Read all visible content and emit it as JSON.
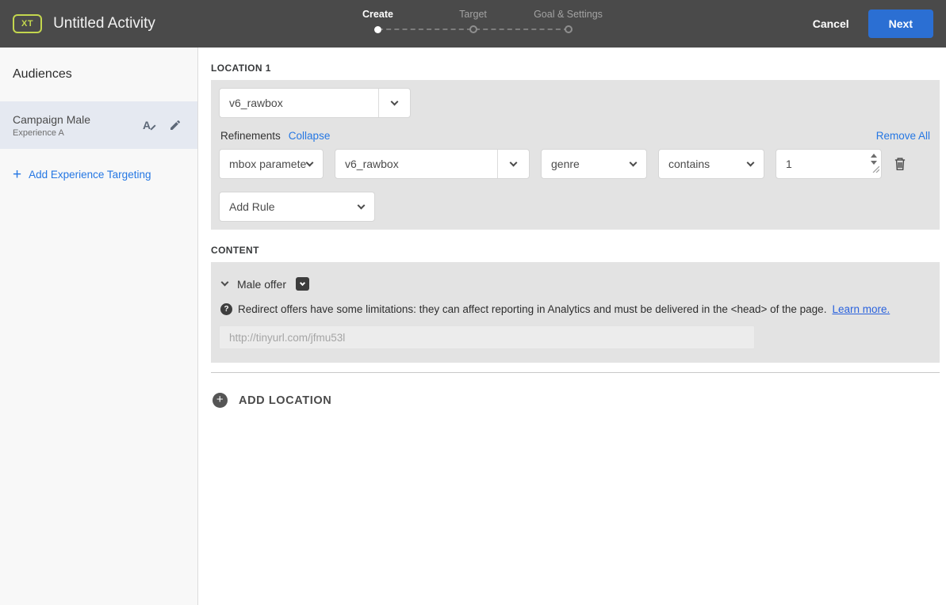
{
  "topbar": {
    "badge": "XT",
    "title": "Untitled Activity",
    "steps": [
      {
        "label": "Create",
        "state": "active"
      },
      {
        "label": "Target",
        "state": "upcoming"
      },
      {
        "label": "Goal & Settings",
        "state": "upcoming"
      }
    ],
    "cancel_label": "Cancel",
    "next_label": "Next"
  },
  "sidebar": {
    "heading": "Audiences",
    "audience": {
      "name": "Campaign Male",
      "experience": "Experience A"
    },
    "add_link": "Add Experience Targeting"
  },
  "location": {
    "heading": "LOCATION 1",
    "mbox_select": "v6_rawbox",
    "refinements_label": "Refinements",
    "collapse_label": "Collapse",
    "remove_all_label": "Remove All",
    "rule": {
      "type": "mbox parameter",
      "parameter": "v6_rawbox",
      "attribute": "genre",
      "operator": "contains",
      "value": "1"
    },
    "add_rule_label": "Add Rule"
  },
  "content": {
    "heading": "CONTENT",
    "offer_name": "Male offer",
    "notice": "Redirect offers have some limitations: they can affect reporting in Analytics and must be delivered in the <head> of the page.",
    "learn_more_label": "Learn more.",
    "url_placeholder": "http://tinyurl.com/jfmu53l"
  },
  "add_location_label": "ADD LOCATION",
  "icons": {
    "plus": "+",
    "question": "?"
  },
  "colors": {
    "topbar_bg": "#4a4a4a",
    "badge_accent": "#c3d64e",
    "primary_button": "#2b6fd3",
    "link_blue": "#2577e3",
    "panel_gray": "#e3e3e3",
    "selected_audience_bg": "#e5e9f1"
  }
}
